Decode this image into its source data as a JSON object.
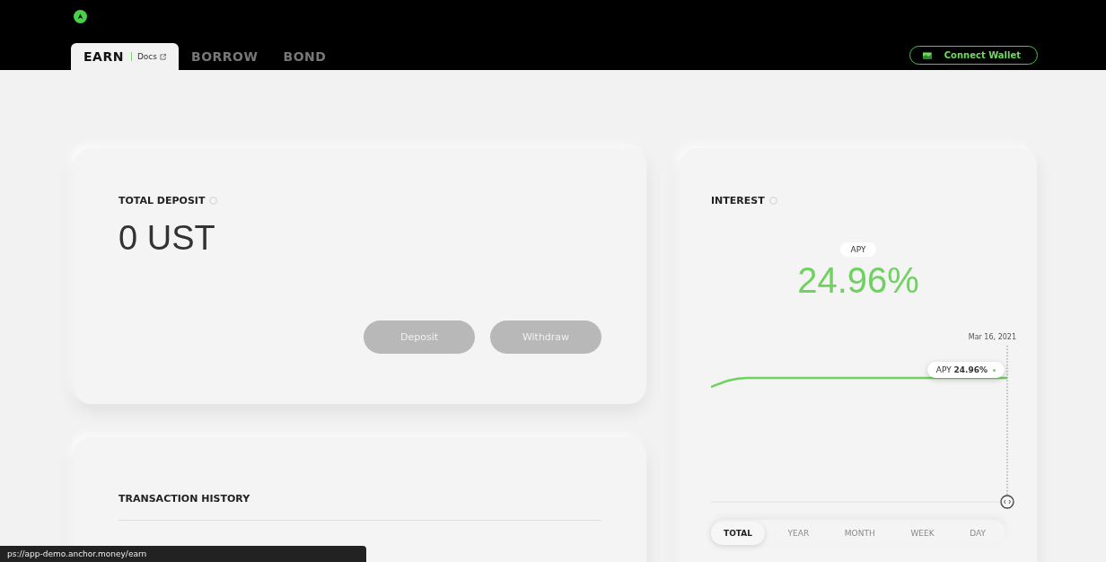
{
  "nav": {
    "tabs": [
      {
        "label": "EARN",
        "selected": true,
        "docs": "Docs"
      },
      {
        "label": "BORROW",
        "selected": false
      },
      {
        "label": "BOND",
        "selected": false
      }
    ],
    "wallet_button": "Connect Wallet"
  },
  "total_deposit": {
    "title": "TOTAL DEPOSIT",
    "amount": "0 UST",
    "buttons": [
      {
        "label": "Deposit",
        "disabled": true
      },
      {
        "label": "Withdraw",
        "disabled": true
      }
    ]
  },
  "transaction_history": {
    "title": "TRANSACTION HISTORY"
  },
  "interest": {
    "title": "INTEREST",
    "apy_badge": "APY",
    "apy_value": "24.96%",
    "chart_date": "Mar 16, 2021",
    "tooltip": "APY **24.96%**",
    "periods": [
      {
        "label": "TOTAL",
        "selected": true
      },
      {
        "label": "YEAR",
        "selected": false
      },
      {
        "label": "MONTH",
        "selected": false
      },
      {
        "label": "WEEK",
        "selected": false
      },
      {
        "label": "DAY",
        "selected": false
      }
    ]
  },
  "status_bar": "ps://app-demo.anchor.money/earn"
}
